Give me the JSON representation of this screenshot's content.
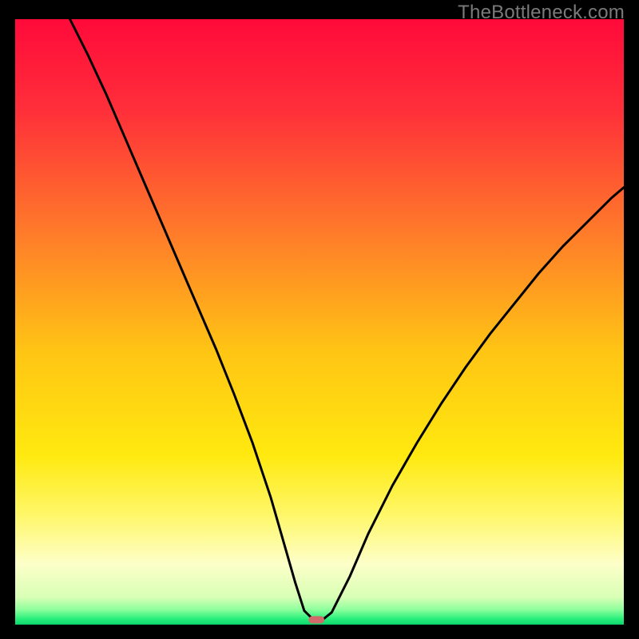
{
  "watermark": "TheBottleneck.com",
  "chart_data": {
    "type": "line",
    "title": "",
    "xlabel": "",
    "ylabel": "",
    "xlim": [
      0,
      100
    ],
    "ylim": [
      0,
      100
    ],
    "grid": false,
    "background": {
      "type": "vertical-gradient",
      "stops": [
        {
          "pos": 0.0,
          "color": "#ff0a3a"
        },
        {
          "pos": 0.15,
          "color": "#ff2f3a"
        },
        {
          "pos": 0.35,
          "color": "#ff7a2a"
        },
        {
          "pos": 0.55,
          "color": "#ffc514"
        },
        {
          "pos": 0.72,
          "color": "#ffe90f"
        },
        {
          "pos": 0.82,
          "color": "#fff76a"
        },
        {
          "pos": 0.9,
          "color": "#fdffc9"
        },
        {
          "pos": 0.955,
          "color": "#d8ffb5"
        },
        {
          "pos": 0.975,
          "color": "#8fff9d"
        },
        {
          "pos": 0.99,
          "color": "#2bf07c"
        },
        {
          "pos": 1.0,
          "color": "#0cd56b"
        }
      ]
    },
    "series": [
      {
        "name": "bottleneck-curve",
        "color": "#000000",
        "stroke_width": 3,
        "x": [
          9,
          12,
          15,
          18,
          21,
          24,
          27,
          30,
          33,
          36,
          39,
          42,
          44,
          46,
          47.5,
          49,
          50.5,
          52,
          55,
          58,
          62,
          66,
          70,
          74,
          78,
          82,
          86,
          90,
          94,
          98,
          100
        ],
        "y_percent": [
          100,
          94,
          87.5,
          80.5,
          73.5,
          66.5,
          59.5,
          52.5,
          45.5,
          38,
          30,
          21,
          14,
          7,
          2.3,
          0.8,
          0.8,
          2.0,
          8,
          15,
          23,
          30,
          36.5,
          42.5,
          48,
          53,
          58,
          62.5,
          66.5,
          70.5,
          72.2
        ]
      }
    ],
    "marker": {
      "name": "optimal-point",
      "x": 49.5,
      "y_percent": 0.8,
      "color": "#d16a6a",
      "shape": "pill",
      "w": 2.6,
      "h": 1.2
    }
  }
}
